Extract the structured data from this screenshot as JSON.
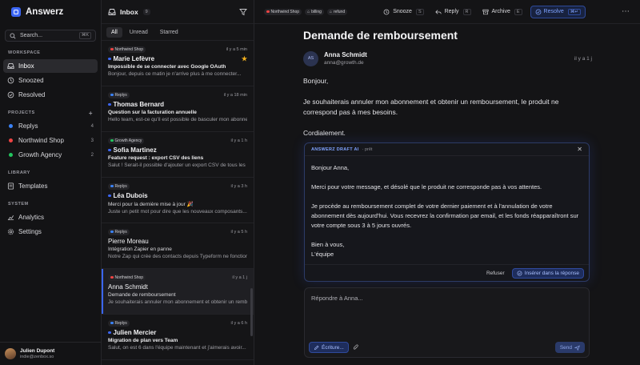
{
  "app": {
    "name": "Answerz"
  },
  "search": {
    "placeholder": "Search...",
    "shortcut": "⌘K"
  },
  "sidebar": {
    "workspace_title": "WORKSPACE",
    "workspace": [
      {
        "label": "Inbox",
        "icon": "inbox-icon"
      },
      {
        "label": "Snoozed",
        "icon": "clock-icon"
      },
      {
        "label": "Resolved",
        "icon": "check-circle-icon"
      }
    ],
    "projects_title": "PROJECTS",
    "projects": [
      {
        "label": "Replys",
        "count": "4",
        "color": "#3b82f6"
      },
      {
        "label": "Northwind Shop",
        "count": "3",
        "color": "#ef4444"
      },
      {
        "label": "Growth Agency",
        "count": "2",
        "color": "#22c55e"
      }
    ],
    "library_title": "LIBRARY",
    "library": [
      {
        "label": "Templates",
        "icon": "template-icon"
      }
    ],
    "system_title": "SYSTEM",
    "system": [
      {
        "label": "Analytics",
        "icon": "chart-icon"
      },
      {
        "label": "Settings",
        "icon": "gear-icon"
      }
    ]
  },
  "user": {
    "name": "Julien Dupont",
    "email": "indie@zenbox.so"
  },
  "inbox": {
    "title": "Inbox",
    "count": "9",
    "tabs": [
      "All",
      "Unread",
      "Starred"
    ],
    "threads": [
      {
        "tag": "Northwind Shop",
        "tag_color": "#ef4444",
        "time": "il y a 5 min",
        "name": "Marie Lefèvre",
        "unread": true,
        "starred": true,
        "subject": "Impossible de se connecter avec Google OAuth",
        "preview": "Bonjour, depuis ce matin je n'arrive plus à me connecter..."
      },
      {
        "tag": "Replys",
        "tag_color": "#3b82f6",
        "time": "il y a 18 min",
        "name": "Thomas Bernard",
        "unread": true,
        "starred": false,
        "subject": "Question sur la facturation annuelle",
        "preview": "Hello team, est-ce qu'il est possible de basculer mon abonnement..."
      },
      {
        "tag": "Growth Agency",
        "tag_color": "#22c55e",
        "time": "il y a 1 h",
        "name": "Sofia Martinez",
        "unread": true,
        "starred": false,
        "subject": "Feature request : export CSV des liens",
        "preview": "Salut ! Serait-il possible d'ajouter un export CSV de tous les liens..."
      },
      {
        "tag": "Replys",
        "tag_color": "#3b82f6",
        "time": "il y a 3 h",
        "name": "Léa Dubois",
        "unread": true,
        "starred": false,
        "subject": "Merci pour la dernière mise à jour 🎉",
        "preview": "Juste un petit mot pour dire que les nouveaux composants..."
      },
      {
        "tag": "Replys",
        "tag_color": "#3b82f6",
        "time": "il y a 5 h",
        "name": "Pierre Moreau",
        "unread": false,
        "starred": false,
        "subject": "Intégration Zapier en panne",
        "preview": "Notre Zap qui crée des contacts depuis Typeform ne fonctionne plus..."
      },
      {
        "tag": "Northwind Shop",
        "tag_color": "#ef4444",
        "time": "il y a 1 j",
        "name": "Anna Schmidt",
        "unread": false,
        "starred": false,
        "subject": "Demande de remboursement",
        "preview": "Je souhaiterais annuler mon abonnement et obtenir un remboursement..."
      },
      {
        "tag": "Replys",
        "tag_color": "#3b82f6",
        "time": "il y a 6 h",
        "name": "Julien Mercier",
        "unread": true,
        "starred": false,
        "subject": "Migration de plan vers Team",
        "preview": "Salut, on est 6 dans l'équipe maintenant et j'aimerais avoir..."
      }
    ]
  },
  "toolbar": {
    "tags": [
      {
        "label": "Northwind Shop",
        "color": "#ef4444"
      },
      {
        "label": "billing"
      },
      {
        "label": "refund"
      }
    ],
    "snooze": "Snooze",
    "snooze_key": "S",
    "reply": "Reply",
    "reply_key": "R",
    "archive": "Archive",
    "archive_key": "E",
    "resolve": "Resolve",
    "resolve_key": "⌘↵"
  },
  "email": {
    "subject": "Demande de remboursement",
    "sender_initials": "AS",
    "sender_name": "Anna Schmidt",
    "sender_email": "anna@growth.de",
    "time": "il y a 1 j",
    "body": [
      "Bonjour,",
      "Je souhaiterais annuler mon abonnement et obtenir un remboursement, le produit ne correspond pas à mes besoins.",
      "Cordialement."
    ]
  },
  "draft": {
    "label": "ANSWERZ DRAFT AI",
    "status": "· prêt",
    "body": [
      "Bonjour Anna,",
      "Merci pour votre message, et désolé que le produit ne corresponde pas à vos attentes.",
      "Je procède au remboursement complet de votre dernier paiement et à l'annulation de votre abonnement dès aujourd'hui. Vous recevrez la confirmation par email, et les fonds réapparaîtront sur votre compte sous 3 à 5 jours ouvrés.",
      "Bien à vous,\nL'équipe"
    ],
    "refuse": "Refuser",
    "insert": "Insérer dans la réponse"
  },
  "reply_box": {
    "placeholder": "Répondre à Anna...",
    "write": "Écriture...",
    "send": "Send"
  }
}
